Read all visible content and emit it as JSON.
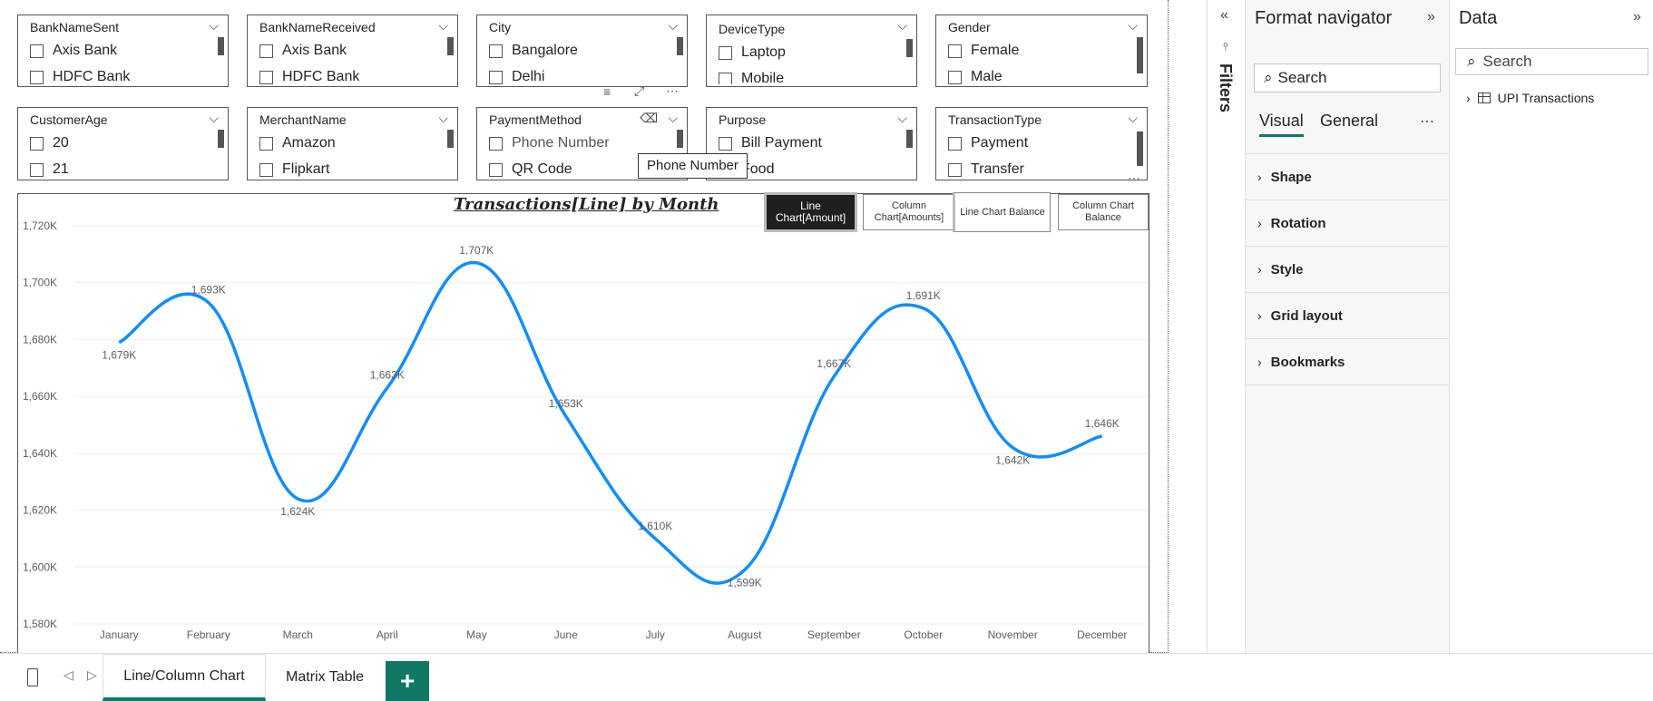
{
  "slicers": [
    {
      "title": "BankNameSent",
      "options": [
        "Axis Bank",
        "HDFC Bank"
      ]
    },
    {
      "title": "BankNameReceived",
      "options": [
        "Axis Bank",
        "HDFC Bank"
      ]
    },
    {
      "title": "City",
      "options": [
        "Bangalore",
        "Delhi"
      ]
    },
    {
      "title": "DeviceType",
      "options": [
        "Laptop",
        "Mobile"
      ]
    },
    {
      "title": "Gender",
      "options": [
        "Female",
        "Male"
      ]
    },
    {
      "title": "CustomerAge",
      "options": [
        "20",
        "21"
      ]
    },
    {
      "title": "MerchantName",
      "options": [
        "Amazon",
        "Flipkart"
      ]
    },
    {
      "title": "PaymentMethod",
      "options": [
        "Phone Number",
        "QR Code"
      ]
    },
    {
      "title": "Purpose",
      "options": [
        "Bill Payment",
        "Food"
      ]
    },
    {
      "title": "TransactionType",
      "options": [
        "Payment",
        "Transfer"
      ]
    }
  ],
  "tooltip": "Phone Number",
  "chart_buttons": [
    "Line Chart[Amount]",
    "Column Chart[Amounts]",
    "Line Chart Balance",
    "Column Chart Balance"
  ],
  "colors": {
    "accent": "#117865",
    "series": "#118DFF"
  },
  "chart_data": {
    "type": "line",
    "title": "Transactions[Line] by Month",
    "categories": [
      "January",
      "February",
      "March",
      "April",
      "May",
      "June",
      "July",
      "August",
      "September",
      "October",
      "November",
      "December"
    ],
    "values": [
      1679,
      1693,
      1624,
      1663,
      1707,
      1653,
      1610,
      1599,
      1667,
      1691,
      1642,
      1646
    ],
    "labels": [
      "1,679K",
      "1,693K",
      "1,624K",
      "1,663K",
      "1,707K",
      "1,653K",
      "1,610K",
      "1,599K",
      "1,667K",
      "1,691K",
      "1,642K",
      "1,646K"
    ],
    "yticks": [
      "1,720K",
      "1,700K",
      "1,680K",
      "1,660K",
      "1,640K",
      "1,620K",
      "1,600K",
      "1,580K"
    ],
    "ylim": [
      1580,
      1720
    ],
    "grid": true,
    "smooth": true
  },
  "tabs": [
    "Line/Column Chart",
    "Matrix Table"
  ],
  "add_tab": "+",
  "filters_label": "Filters",
  "format_pane": {
    "title": "Format navigator",
    "search": "Search",
    "tabs": [
      "Visual",
      "General"
    ],
    "sections": [
      "Shape",
      "Rotation",
      "Style",
      "Grid layout",
      "Bookmarks"
    ]
  },
  "data_pane": {
    "title": "Data",
    "search": "Search",
    "tables": [
      "UPI Transactions"
    ]
  }
}
